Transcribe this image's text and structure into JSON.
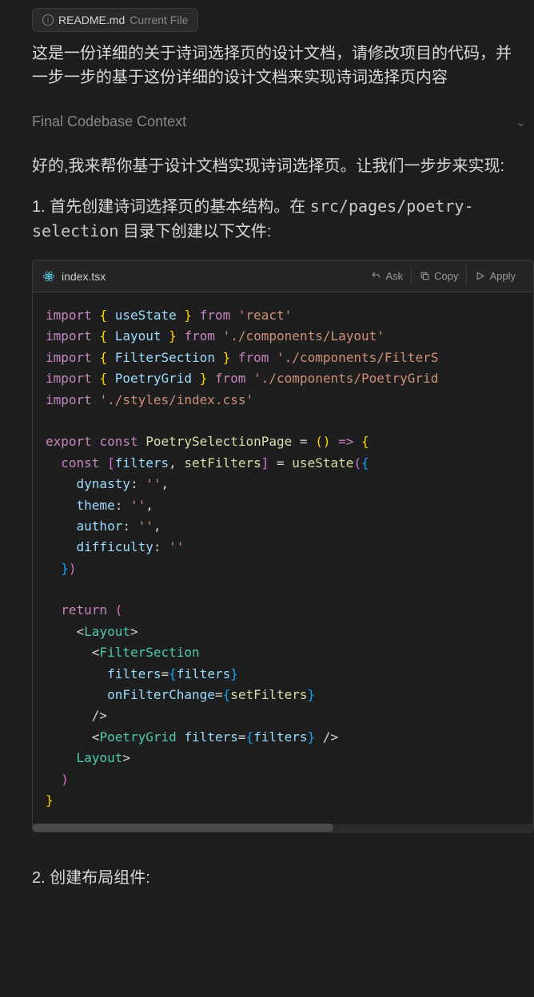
{
  "file_chip": {
    "filename": "README.md",
    "badge": "Current File"
  },
  "user_message": "这是一份详细的关于诗词选择页的设计文档，请修改项目的代码，并一步一步的基于这份详细的设计文档来实现诗词选择页内容",
  "context_header": "Final Codebase Context",
  "assistant_intro": "好的,我来帮你基于设计文档实现诗词选择页。让我们一步步来实现:",
  "step1_prefix": "1. 首先创建诗词选择页的基本结构。在 ",
  "step1_path": "src/pages/poetry-selection",
  "step1_suffix": " 目录下创建以下文件:",
  "code_block": {
    "filename": "index.tsx",
    "actions": {
      "ask": "Ask",
      "copy": "Copy",
      "apply": "Apply"
    }
  },
  "code_tokens": [
    [
      [
        "kw",
        "import"
      ],
      [
        "op",
        " "
      ],
      [
        "br",
        "{"
      ],
      [
        "op",
        " "
      ],
      [
        "id",
        "useState"
      ],
      [
        "op",
        " "
      ],
      [
        "br",
        "}"
      ],
      [
        "op",
        " "
      ],
      [
        "kw",
        "from"
      ],
      [
        "op",
        " "
      ],
      [
        "str",
        "'react'"
      ]
    ],
    [
      [
        "kw",
        "import"
      ],
      [
        "op",
        " "
      ],
      [
        "br",
        "{"
      ],
      [
        "op",
        " "
      ],
      [
        "id",
        "Layout"
      ],
      [
        "op",
        " "
      ],
      [
        "br",
        "}"
      ],
      [
        "op",
        " "
      ],
      [
        "kw",
        "from"
      ],
      [
        "op",
        " "
      ],
      [
        "str",
        "'./components/Layout'"
      ]
    ],
    [
      [
        "kw",
        "import"
      ],
      [
        "op",
        " "
      ],
      [
        "br",
        "{"
      ],
      [
        "op",
        " "
      ],
      [
        "id",
        "FilterSection"
      ],
      [
        "op",
        " "
      ],
      [
        "br",
        "}"
      ],
      [
        "op",
        " "
      ],
      [
        "kw",
        "from"
      ],
      [
        "op",
        " "
      ],
      [
        "str",
        "'./components/FilterS"
      ]
    ],
    [
      [
        "kw",
        "import"
      ],
      [
        "op",
        " "
      ],
      [
        "br",
        "{"
      ],
      [
        "op",
        " "
      ],
      [
        "id",
        "PoetryGrid"
      ],
      [
        "op",
        " "
      ],
      [
        "br",
        "}"
      ],
      [
        "op",
        " "
      ],
      [
        "kw",
        "from"
      ],
      [
        "op",
        " "
      ],
      [
        "str",
        "'./components/PoetryGrid"
      ]
    ],
    [
      [
        "kw",
        "import"
      ],
      [
        "op",
        " "
      ],
      [
        "str",
        "'./styles/index.css'"
      ]
    ],
    [],
    [
      [
        "kw",
        "export"
      ],
      [
        "op",
        " "
      ],
      [
        "kw",
        "const"
      ],
      [
        "op",
        " "
      ],
      [
        "fn",
        "PoetrySelectionPage"
      ],
      [
        "op",
        " = "
      ],
      [
        "br",
        "("
      ],
      [
        "br",
        ")"
      ],
      [
        "op",
        " "
      ],
      [
        "kw",
        "=>"
      ],
      [
        "op",
        " "
      ],
      [
        "br",
        "{"
      ]
    ],
    [
      [
        "op",
        "  "
      ],
      [
        "kw",
        "const"
      ],
      [
        "op",
        " "
      ],
      [
        "brpink",
        "["
      ],
      [
        "id",
        "filters"
      ],
      [
        "op",
        ", "
      ],
      [
        "fn",
        "setFilters"
      ],
      [
        "brpink",
        "]"
      ],
      [
        "op",
        " = "
      ],
      [
        "fn",
        "useState"
      ],
      [
        "brpink",
        "("
      ],
      [
        "brblue",
        "{"
      ]
    ],
    [
      [
        "op",
        "    "
      ],
      [
        "id",
        "dynasty"
      ],
      [
        "op",
        ": "
      ],
      [
        "str",
        "''"
      ],
      [
        "op",
        ","
      ]
    ],
    [
      [
        "op",
        "    "
      ],
      [
        "id",
        "theme"
      ],
      [
        "op",
        ": "
      ],
      [
        "str",
        "''"
      ],
      [
        "op",
        ","
      ]
    ],
    [
      [
        "op",
        "    "
      ],
      [
        "id",
        "author"
      ],
      [
        "op",
        ": "
      ],
      [
        "str",
        "''"
      ],
      [
        "op",
        ","
      ]
    ],
    [
      [
        "op",
        "    "
      ],
      [
        "id",
        "difficulty"
      ],
      [
        "op",
        ": "
      ],
      [
        "str",
        "''"
      ]
    ],
    [
      [
        "op",
        "  "
      ],
      [
        "brblue",
        "}"
      ],
      [
        "brpink",
        ")"
      ]
    ],
    [],
    [
      [
        "op",
        "  "
      ],
      [
        "kw",
        "return"
      ],
      [
        "op",
        " "
      ],
      [
        "brpink",
        "("
      ]
    ],
    [
      [
        "op",
        "    "
      ],
      [
        "op",
        "<"
      ],
      [
        "tag",
        "Layout"
      ],
      [
        "op",
        ">"
      ]
    ],
    [
      [
        "op",
        "      "
      ],
      [
        "op",
        "<"
      ],
      [
        "tag",
        "FilterSection"
      ]
    ],
    [
      [
        "op",
        "        "
      ],
      [
        "attr",
        "filters"
      ],
      [
        "op",
        "="
      ],
      [
        "brblue",
        "{"
      ],
      [
        "id",
        "filters"
      ],
      [
        "brblue",
        "}"
      ]
    ],
    [
      [
        "op",
        "        "
      ],
      [
        "attr",
        "onFilterChange"
      ],
      [
        "op",
        "="
      ],
      [
        "brblue",
        "{"
      ],
      [
        "fn",
        "setFilters"
      ],
      [
        "brblue",
        "}"
      ]
    ],
    [
      [
        "op",
        "      "
      ],
      [
        "op",
        "/>"
      ]
    ],
    [
      [
        "op",
        "      "
      ],
      [
        "op",
        "<"
      ],
      [
        "tag",
        "PoetryGrid"
      ],
      [
        "op",
        " "
      ],
      [
        "attr",
        "filters"
      ],
      [
        "op",
        "="
      ],
      [
        "brblue",
        "{"
      ],
      [
        "id",
        "filters"
      ],
      [
        "brblue",
        "}"
      ],
      [
        "op",
        " />"
      ]
    ],
    [
      [
        "op",
        "    "
      ],
      [
        "op",
        "</"
      ],
      [
        "tag",
        "Layout"
      ],
      [
        "op",
        ">"
      ]
    ],
    [
      [
        "op",
        "  "
      ],
      [
        "brpink",
        ")"
      ]
    ],
    [
      [
        "br",
        "}"
      ]
    ]
  ],
  "step2": "2. 创建布局组件:"
}
